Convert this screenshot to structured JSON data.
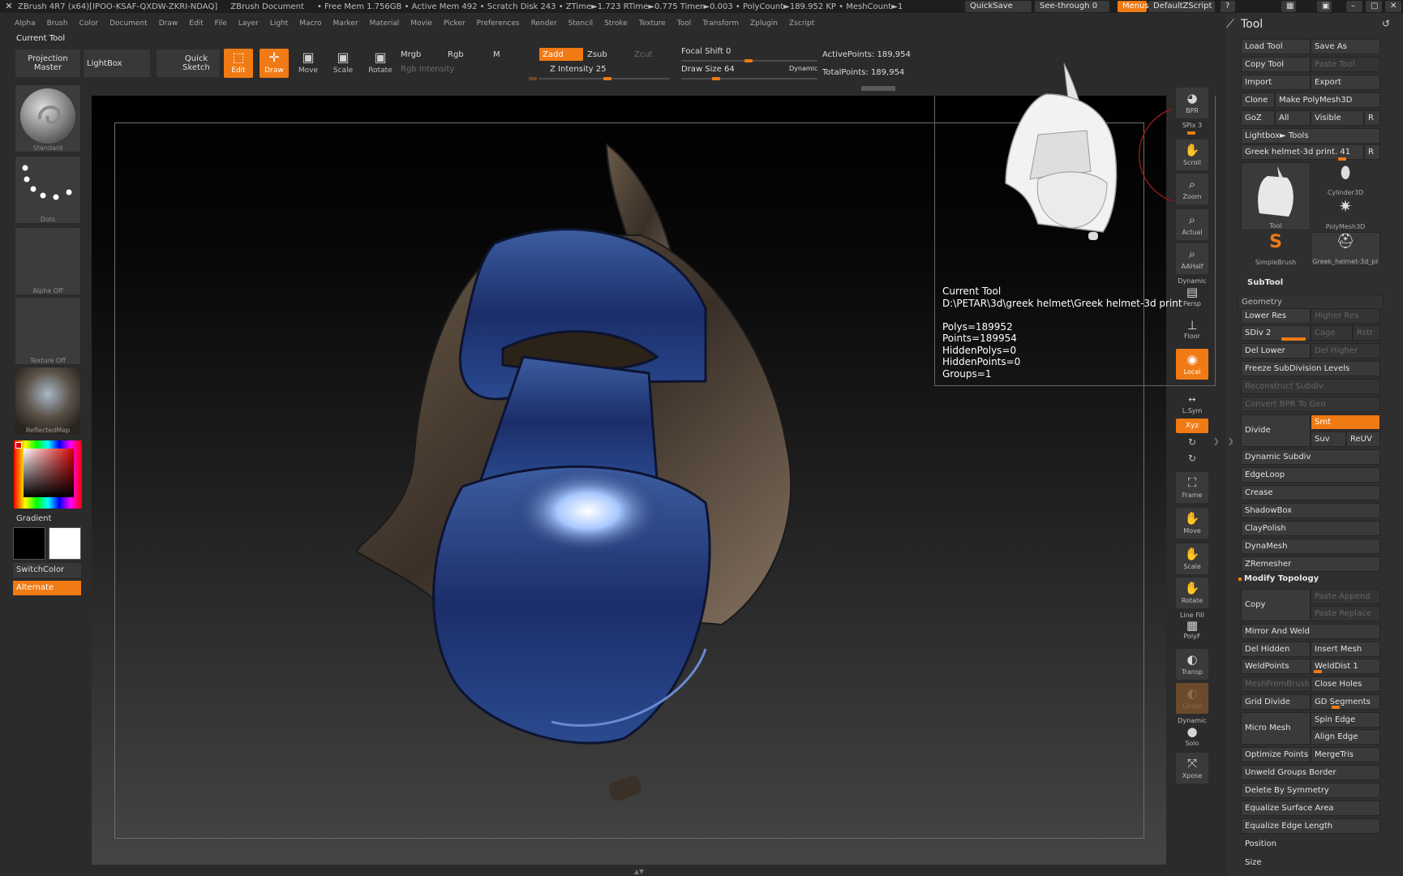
{
  "titlebar": {
    "app": "ZBrush 4R7 (x64)[IPOO-KSAF-QXDW-ZKRI-NDAQ]",
    "doc": "ZBrush Document",
    "stats": "• Free Mem 1.756GB • Active Mem 492 • Scratch Disk 243 • ZTime►1.723 RTime►0.775 Timer►0.003 • PolyCount►189.952 KP • MeshCount►1",
    "quicksave": "QuickSave",
    "seethrough": "See-through 0",
    "menus": "Menus",
    "script": "DefaultZScript"
  },
  "menus": [
    "Alpha",
    "Brush",
    "Color",
    "Document",
    "Draw",
    "Edit",
    "File",
    "Layer",
    "Light",
    "Macro",
    "Marker",
    "Material",
    "Movie",
    "Picker",
    "Preferences",
    "Render",
    "Stencil",
    "Stroke",
    "Texture",
    "Tool",
    "Transform",
    "Zplugin",
    "Zscript"
  ],
  "current_tool_label": "Current Tool",
  "shelf": {
    "projection_master": "Projection Master",
    "lightbox": "LightBox",
    "quick_sketch": "Quick Sketch",
    "edit": "Edit",
    "draw": "Draw",
    "move": "Move",
    "scale": "Scale",
    "rotate": "Rotate",
    "mrgb": "Mrgb",
    "rgb": "Rgb",
    "m": "M",
    "rgb_intensity": "Rgb Intensity",
    "zadd": "Zadd",
    "zsub": "Zsub",
    "zcut": "Zcut",
    "z_intensity": "Z Intensity 25",
    "focal_shift": "Focal Shift 0",
    "draw_size": "Draw Size 64",
    "dynamic": "Dynamic",
    "active_points": "ActivePoints: 189,954",
    "total_points": "TotalPoints: 189,954"
  },
  "left": {
    "standard": "Standard",
    "dots": "Dots",
    "alpha": "Alpha Off",
    "texture": "Texture Off",
    "material": "ReflectedMap",
    "gradient": "Gradient",
    "switchcolor": "SwitchColor",
    "alternate": "Alternate"
  },
  "info": {
    "text": "Current Tool\nD:\\PETAR\\3d\\greek helmet\\Greek helmet-3d print\n\nPolys=189952\nPoints=189954\nHiddenPolys=0\nHiddenPoints=0\nGroups=1"
  },
  "vtools": {
    "bpr": "BPR",
    "spix": "SPix 3",
    "scroll": "Scroll",
    "zoom": "Zoom",
    "actual": "Actual",
    "aahalf": "AAHalf",
    "dynamic": "Dynamic",
    "persp": "Persp",
    "floor": "Floor",
    "local": "Local",
    "lsym": "L.Sym",
    "xyz": "Xyz",
    "frame": "Frame",
    "move": "Move",
    "scale": "Scale",
    "rotate": "Rotate",
    "linefill": "Line Fill",
    "polyf": "PolyF",
    "transp": "Transp",
    "ghost": "Ghost",
    "dynamic2": "Dynamic",
    "solo": "Solo",
    "xpose": "Xpose"
  },
  "tool_panel": {
    "title": "Tool",
    "load_tool": "Load Tool",
    "save_as": "Save As",
    "copy_tool": "Copy Tool",
    "paste_tool": "Paste Tool",
    "import": "Import",
    "export": "Export",
    "clone": "Clone",
    "make_polymesh": "Make PolyMesh3D",
    "goz": "GoZ",
    "all": "All",
    "visible": "Visible",
    "r": "R",
    "lightbox_tools": "Lightbox► Tools",
    "tool_name": "Greek helmet-3d print. 41",
    "thumbs": [
      "Tool",
      "Cylinder3D",
      "PolyMesh3D",
      "SimpleBrush",
      "Greek_helmet-3d_pr"
    ],
    "subtool": "SubTool",
    "geometry": "Geometry",
    "lower_res": "Lower Res",
    "higher_res": "Higher Res",
    "sdiv": "SDiv 2",
    "cage": "Cage",
    "rstr": "Rstr",
    "del_lower": "Del Lower",
    "del_higher": "Del Higher",
    "freeze": "Freeze SubDivision Levels",
    "reconstruct": "Reconstruct Subdiv",
    "convert_bpr": "Convert BPR To Geo",
    "divide": "Divide",
    "smt": "Smt",
    "suv": "Suv",
    "reuv": "ReUV",
    "dynamic_subdiv": "Dynamic Subdiv",
    "edgeloop": "EdgeLoop",
    "crease": "Crease",
    "shadowbox": "ShadowBox",
    "claypolish": "ClayPolish",
    "dynamesh": "DynaMesh",
    "zremesher": "ZRemesher",
    "modify_topology": "Modify Topology",
    "copy": "Copy",
    "paste_append": "Paste Append",
    "paste_replace": "Paste Replace",
    "mirror_weld": "Mirror And Weld",
    "del_hidden": "Del Hidden",
    "insert_mesh": "Insert Mesh",
    "weldpoints": "WeldPoints",
    "welddist": "WeldDist 1",
    "meshfrombrush": "MeshFromBrush",
    "close_holes": "Close Holes",
    "grid_divide": "Grid Divide",
    "gd_segments": "GD Segments",
    "micro_mesh": "Micro Mesh",
    "spin_edge": "Spin Edge",
    "align_edge": "Align Edge",
    "optimize_points": "Optimize Points",
    "mergetris": "MergeTris",
    "unweld": "Unweld Groups Border",
    "delete_symmetry": "Delete By Symmetry",
    "equalize_surface": "Equalize Surface Area",
    "equalize_edge": "Equalize Edge Length",
    "position": "Position",
    "size": "Size"
  },
  "colors": {
    "accent": "#f07a14",
    "bg": "#2b2b2b",
    "panel": "#2f2f2f"
  }
}
